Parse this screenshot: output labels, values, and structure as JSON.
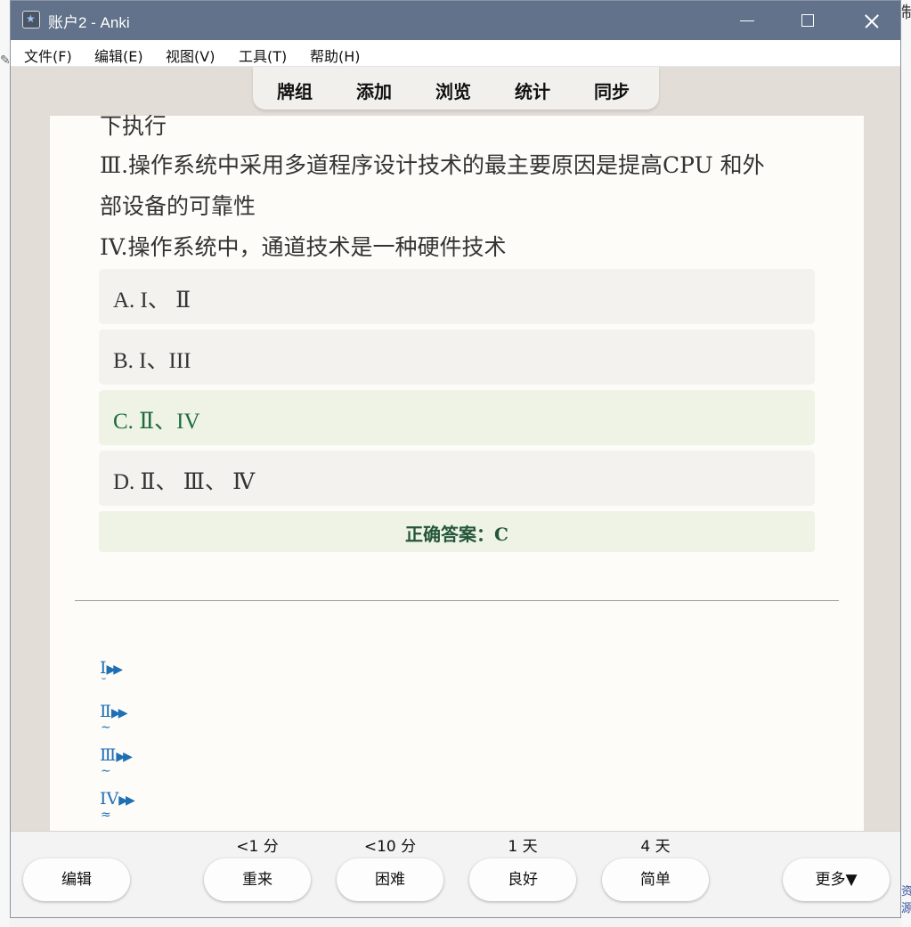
{
  "window": {
    "title": "账户2 - Anki"
  },
  "menubar": {
    "items": [
      "文件(F)",
      "编辑(E)",
      "视图(V)",
      "工具(T)",
      "帮助(H)"
    ]
  },
  "toolbar": {
    "items": [
      "牌组",
      "添加",
      "浏览",
      "统计",
      "同步"
    ]
  },
  "card": {
    "partial_line": "下执行",
    "statement_3_line1": "Ⅲ.操作系统中采用多道程序设计技术的最主要原因是提高CPU 和外",
    "statement_3_line2": "部设备的可靠性",
    "statement_4": "IV.操作系统中，通道技术是一种硬件技术",
    "options": [
      {
        "label": "A. I、 Ⅱ",
        "correct": false
      },
      {
        "label": "B. I、III",
        "correct": false
      },
      {
        "label": "C. Ⅱ、IV",
        "correct": true
      },
      {
        "label": "D. Ⅱ、 Ⅲ、 Ⅳ",
        "correct": false
      }
    ],
    "answer_text": "正确答案：C",
    "roman_list": [
      "Ⅰ",
      "Ⅱ",
      "Ⅲ",
      "IV"
    ],
    "arrow_glyph": "▶▶"
  },
  "bottombar": {
    "edit_label": "编辑",
    "more_label": "更多▼",
    "answers": [
      {
        "interval": "<1 分",
        "label": "重来"
      },
      {
        "interval": "<10 分",
        "label": "困难"
      },
      {
        "interval": "1 天",
        "label": "良好"
      },
      {
        "interval": "4 天",
        "label": "简单"
      }
    ]
  },
  "background": {
    "right_char": "制",
    "right_link": "资源"
  },
  "colors": {
    "titlebar": "#61728a",
    "correct_bg": "#eef3e6",
    "correct_text": "#1e6b3c",
    "link_blue": "#1f6fb5"
  }
}
